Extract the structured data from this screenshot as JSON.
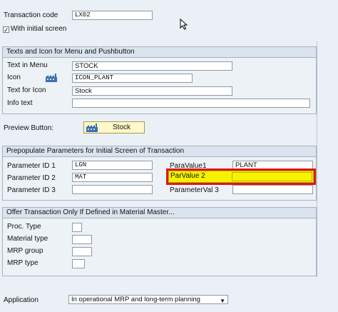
{
  "header": {
    "transaction_code_label": "Transaction code",
    "transaction_code_value": "LX02",
    "with_initial_screen_label": "With initial screen",
    "with_initial_screen_checked": true
  },
  "menu_group": {
    "title": "Texts and Icon for Menu and Pushbutton",
    "text_in_menu_label": "Text in Menu",
    "text_in_menu_value": "STOCK",
    "icon_label": "Icon",
    "icon_value": "ICON_PLANT",
    "text_for_icon_label": "Text for Icon",
    "text_for_icon_value": "Stock",
    "info_text_label": "Info text",
    "info_text_value": ""
  },
  "preview": {
    "label": "Preview Button:",
    "button_label": "Stock"
  },
  "params_group": {
    "title": "Prepopulate Parameters for Initial Screen of Transaction",
    "rows": [
      {
        "id_label": "Parameter ID 1",
        "id_value": "LGN",
        "val_label": "ParaValue1",
        "val_value": "PLANT"
      },
      {
        "id_label": "Parameter ID 2",
        "id_value": "MAT",
        "val_label": "ParValue 2",
        "val_value": ""
      },
      {
        "id_label": "Parameter ID 3",
        "id_value": "",
        "val_label": "ParameterVal 3",
        "val_value": ""
      }
    ]
  },
  "material_group": {
    "title": "Offer Transaction Only If Defined in Material Master...",
    "proc_type_label": "Proc. Type",
    "material_type_label": "Material type",
    "mrp_group_label": "MRP group",
    "mrp_type_label": "MRP type"
  },
  "application": {
    "label": "Application",
    "value": "In operational MRP and long-term planning"
  },
  "colors": {
    "highlight_border": "#e2141c",
    "highlight_fill": "#f7f200",
    "button_fill": "#fff8c8"
  }
}
